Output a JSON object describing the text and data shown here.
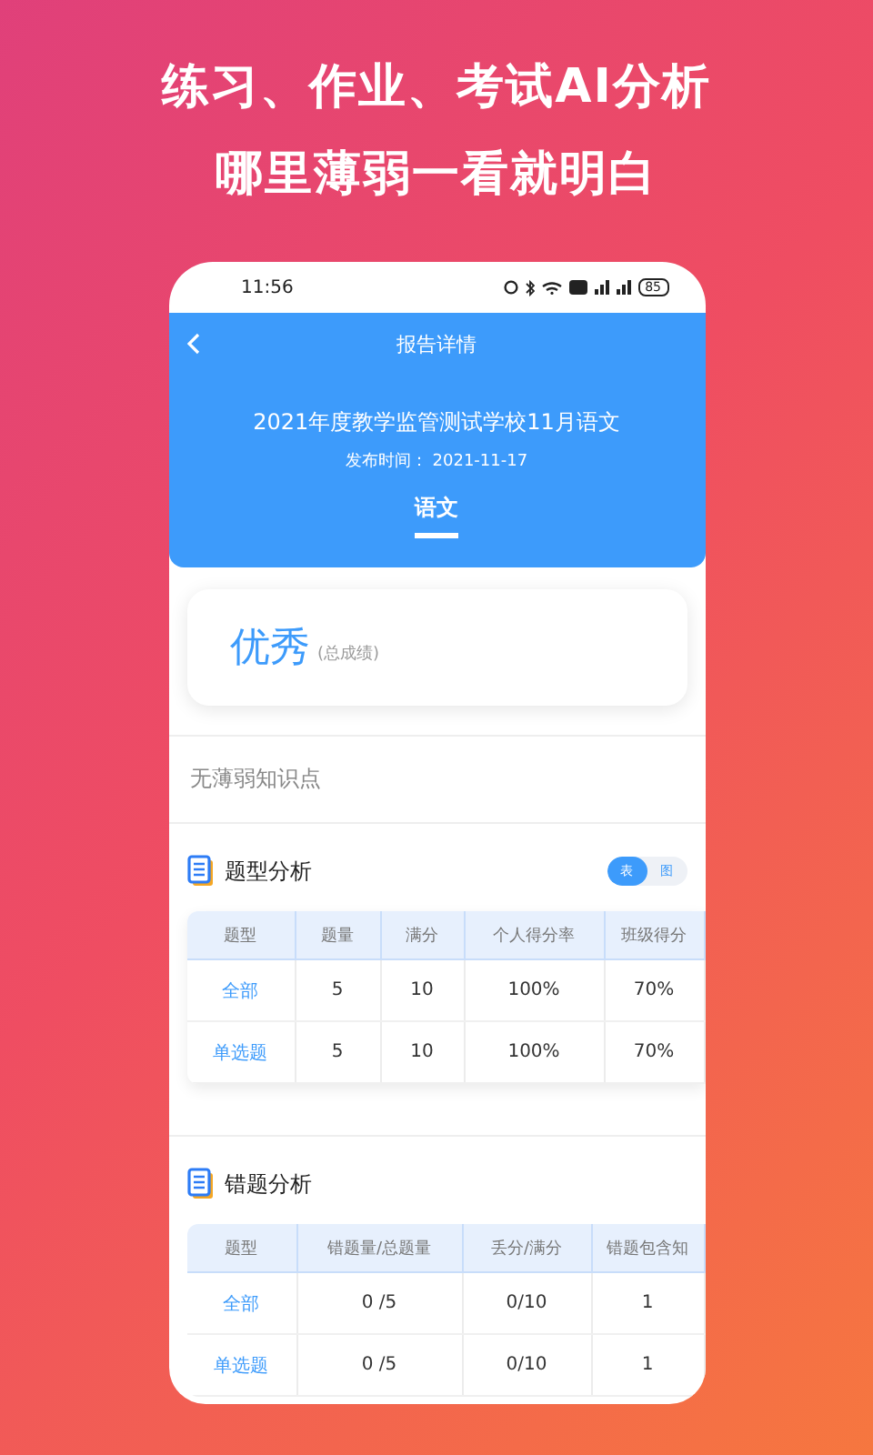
{
  "headline": [
    "练习、作业、考试AI分析",
    "哪里薄弱一看就明白"
  ],
  "status_bar": {
    "time": "11:56",
    "battery": "85"
  },
  "header": {
    "title": "报告详情",
    "exam_title": "2021年度教学监管测试学校11月语文",
    "publish": "发布时间：  2021-11-17",
    "tabs": [
      {
        "label": "语文",
        "selected": true
      }
    ]
  },
  "grade": {
    "value": "优秀",
    "note": "(总成绩)"
  },
  "weak_points": "无薄弱知识点",
  "sections": [
    {
      "title": "题型分析",
      "toggle": [
        {
          "label": "表",
          "selected": true
        },
        {
          "label": "图",
          "selected": false
        }
      ],
      "columns": [
        "题型",
        "题量",
        "满分",
        "个人得分率",
        "班级得分"
      ],
      "rows": [
        [
          "全部",
          "5",
          "10",
          "100%",
          "70%"
        ],
        [
          "单选题",
          "5",
          "10",
          "100%",
          "70%"
        ]
      ]
    },
    {
      "title": "错题分析",
      "columns": [
        "题型",
        "错题量/总题量",
        "丢分/满分",
        "错题包含知"
      ],
      "rows": [
        [
          "全部",
          "0 /5",
          "0/10",
          "1"
        ],
        [
          "单选题",
          "0 /5",
          "0/10",
          "1"
        ]
      ]
    }
  ]
}
